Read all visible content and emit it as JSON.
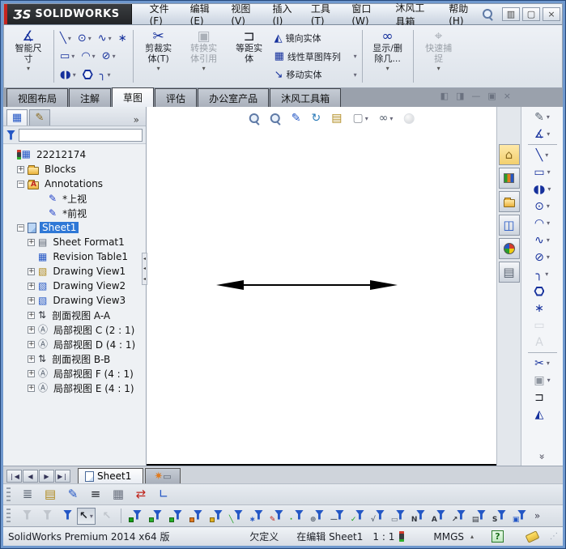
{
  "app": {
    "logo_mark": "ƷS",
    "logo_text": "SOLIDWORKS"
  },
  "menu_bar": {
    "items": [
      "文件(F)",
      "编辑(E)",
      "视图(V)",
      "插入(I)",
      "工具(T)",
      "窗口(W)",
      "沐风工具箱",
      "帮助(H)"
    ]
  },
  "window_controls": [
    {
      "name": "app-minimize-button",
      "glyph": "▥"
    },
    {
      "name": "app-restore-button",
      "glyph": "▢"
    },
    {
      "name": "app-close-button",
      "glyph": "×"
    }
  ],
  "icons": {
    "smart-dimension": {
      "g": "∡",
      "c": "#15309c"
    },
    "line": {
      "g": "╲",
      "c": "#15309c"
    },
    "rectangle": {
      "g": "▭",
      "c": "#15309c"
    },
    "slot": {
      "g": "◖◗",
      "c": "#15309c"
    },
    "circle": {
      "g": "⊙",
      "c": "#15309c"
    },
    "arc": {
      "g": "◠",
      "c": "#15309c"
    },
    "polygon": {
      "cls": "hex"
    },
    "spline": {
      "g": "∿",
      "c": "#15309c"
    },
    "ellipse": {
      "g": "⊘",
      "c": "#15309c"
    },
    "fillet": {
      "g": "╮",
      "c": "#15309c"
    },
    "point": {
      "g": "∗",
      "c": "#15309c"
    },
    "trim": {
      "g": "✂",
      "c": "#15309c"
    },
    "convert-entities": {
      "g": "▣",
      "c": "#8d949e"
    },
    "offset": {
      "g": "⊐",
      "c": "#1c1f26"
    },
    "mirror": {
      "g": "◭",
      "c": "#15309c"
    },
    "linear-pattern": {
      "g": "▦",
      "c": "#15309c"
    },
    "move": {
      "g": "↘",
      "c": "#15309c"
    },
    "display-delete-relations": {
      "g": "∞",
      "c": "#15309c"
    },
    "quick-snaps": {
      "g": "⌖",
      "c": "#8d949e"
    },
    "sketch": {
      "g": "✎",
      "c": "#5a6472"
    },
    "plane": {
      "g": "▭",
      "c": "#aab0b8"
    },
    "text": {
      "g": "A",
      "c": "#aab0b8"
    },
    "zoom-to-fit": {
      "cls": "mag"
    },
    "zoom-to-area": {
      "cls": "mag"
    },
    "zoom-to-selection": {
      "g": "✎",
      "c": "#2457c5"
    },
    "rotate-view": {
      "g": "↻",
      "c": "#2a7ab8"
    },
    "3d-drawing-view": {
      "g": "▤",
      "c": "#b08a1e"
    },
    "view-orientation": {
      "g": "▢",
      "c": "#878d96"
    },
    "hide-show-items": {
      "g": "∞",
      "c": "#5a6472"
    },
    "apply-scene": {
      "cls": "sphere"
    },
    "home": {
      "g": "⌂",
      "c": "#8a6a1f"
    },
    "design-library": {
      "cls": "books"
    },
    "file-explorer": {
      "cls": "folder"
    },
    "view-palette": {
      "g": "◫",
      "c": "#2457c5"
    },
    "appearances": {
      "cls": "ball"
    },
    "custom-properties": {
      "g": "▤",
      "c": "#5a6472"
    },
    "fm-tree": {
      "g": "▦",
      "c": "#2457c5"
    },
    "pm-hand": {
      "g": "✎",
      "c": "#8a6a1f"
    },
    "filter-funnel": {
      "cls": "funnel-solo"
    },
    "tree-root": {
      "cls": "root"
    },
    "blocks": {
      "cls": "folder"
    },
    "annotations": {
      "cls": "folder folderA"
    },
    "view-annotation": {
      "g": "✎",
      "c": "#2141c8"
    },
    "sheet": {
      "cls": "page pageb"
    },
    "sheet-format": {
      "g": "▤",
      "c": "#5a6472"
    },
    "revision-table": {
      "g": "▦",
      "c": "#2457c5"
    },
    "drawing-view-gold": {
      "g": "▧",
      "c": "#b08a1e"
    },
    "drawing-view": {
      "g": "▧",
      "c": "#2457c5"
    },
    "section-view": {
      "g": "⇅",
      "c": "#30343c"
    },
    "detail-view": {
      "g": "Ⓐ",
      "c": "#5a6472"
    },
    "layer-properties": {
      "g": "≣",
      "c": "#5a6472"
    },
    "document-layers": {
      "g": "▤",
      "c": "#b08a1e"
    },
    "line-color": {
      "g": "✎",
      "c": "#2457c5"
    },
    "line-thickness": {
      "g": "≡",
      "c": "#1c1f26"
    },
    "line-style": {
      "g": "▦",
      "c": "#6b7280"
    },
    "color-display-mode": {
      "g": "⇄",
      "c": "#c0251d"
    },
    "hide-show-edges": {
      "g": "∟",
      "c": "#2457c5"
    },
    "add-sheet": {
      "g": "✷",
      "c": "#e07b1f"
    }
  },
  "ribbon": {
    "smart_dimension": {
      "name": "smart-dimension-button",
      "icon": "smart-dimension",
      "lines": [
        "智能尺",
        "寸"
      ],
      "dropdown": true
    },
    "sketch_grid": [
      [
        {
          "name": "line-tool",
          "icon": "line",
          "dd": true
        },
        {
          "name": "circle-tool",
          "icon": "circle",
          "dd": true
        },
        {
          "name": "spline-tool",
          "icon": "spline",
          "dd": true
        },
        {
          "name": "point-tool",
          "icon": "point",
          "dd": false
        }
      ],
      [
        {
          "name": "rectangle-tool",
          "icon": "rectangle",
          "dd": true
        },
        {
          "name": "arc-tool",
          "icon": "arc",
          "dd": true
        },
        {
          "name": "ellipse-tool",
          "icon": "ellipse",
          "dd": true
        }
      ],
      [
        {
          "name": "slot-tool",
          "icon": "slot",
          "dd": true
        },
        {
          "name": "polygon-tool",
          "icon": "polygon",
          "dd": false
        },
        {
          "name": "fillet-tool",
          "icon": "fillet",
          "dd": true
        }
      ]
    ],
    "big_buttons": [
      {
        "name": "trim-entities-button",
        "icon": "trim",
        "lines": [
          "剪裁实",
          "体(T)"
        ],
        "dropdown": true
      },
      {
        "name": "convert-entities-button",
        "icon": "convert-entities",
        "lines": [
          "转换实",
          "体引用"
        ],
        "dropdown": true,
        "disabled": true
      },
      {
        "name": "offset-entities-button",
        "icon": "offset",
        "lines": [
          "等距实",
          "体"
        ],
        "dropdown": false
      }
    ],
    "stack_buttons": [
      {
        "name": "mirror-entities-button",
        "icon": "mirror",
        "label": "镜向实体",
        "dd": false
      },
      {
        "name": "linear-sketch-pattern-button",
        "icon": "linear-pattern",
        "label": "线性草图阵列",
        "dd": true
      },
      {
        "name": "move-entities-button",
        "icon": "move",
        "label": "移动实体",
        "dd": true
      }
    ],
    "big_buttons2": [
      {
        "name": "display-delete-relations-button",
        "icon": "display-delete-relations",
        "lines": [
          "显示/删",
          "除几..."
        ],
        "dropdown": true
      },
      {
        "name": "quick-snaps-button",
        "icon": "quick-snaps",
        "lines": [
          "快速捕",
          "捉"
        ],
        "dropdown": true,
        "disabled": true
      }
    ]
  },
  "command_tabs": {
    "items": [
      "视图布局",
      "注解",
      "草图",
      "评估",
      "办公室产品",
      "沐风工具箱"
    ],
    "active": "草图"
  },
  "doc_controls": [
    {
      "name": "collapse-pane-left-button",
      "glyph": "◧"
    },
    {
      "name": "collapse-pane-right-button",
      "glyph": "◨"
    },
    {
      "name": "doc-minimize-button",
      "glyph": "—"
    },
    {
      "name": "doc-restore-button",
      "glyph": "▣"
    },
    {
      "name": "doc-close-button",
      "glyph": "×"
    }
  ],
  "left_panel": {
    "tabs": [
      {
        "name": "featuremanager-tree-tab",
        "icon": "fm-tree",
        "active": true
      },
      {
        "name": "propertymanager-tab",
        "icon": "pm-hand",
        "active": false
      }
    ],
    "more_glyph": "»",
    "filter": {
      "value": "",
      "placeholder": ""
    }
  },
  "feature_tree": [
    {
      "label": "22212174",
      "depth": 0,
      "icon": "tree-root",
      "expand": null,
      "selected": false
    },
    {
      "label": "Blocks",
      "depth": 1,
      "icon": "blocks",
      "expand": "+",
      "selected": false
    },
    {
      "label": "Annotations",
      "depth": 1,
      "icon": "annotations",
      "expand": "-",
      "selected": false
    },
    {
      "label": "*上视",
      "depth": 3,
      "icon": "view-annotation",
      "expand": null,
      "selected": false
    },
    {
      "label": "*前视",
      "depth": 3,
      "icon": "view-annotation",
      "expand": null,
      "selected": false
    },
    {
      "label": "Sheet1",
      "depth": 1,
      "icon": "sheet",
      "expand": "-",
      "selected": true
    },
    {
      "label": "Sheet Format1",
      "depth": 2,
      "icon": "sheet-format",
      "expand": "+",
      "selected": false
    },
    {
      "label": "Revision Table1",
      "depth": 2,
      "icon": "revision-table",
      "expand": null,
      "selected": false
    },
    {
      "label": "Drawing View1",
      "depth": 2,
      "icon": "drawing-view-gold",
      "expand": "+",
      "selected": false
    },
    {
      "label": "Drawing View2",
      "depth": 2,
      "icon": "drawing-view",
      "expand": "+",
      "selected": false
    },
    {
      "label": "Drawing View3",
      "depth": 2,
      "icon": "drawing-view",
      "expand": "+",
      "selected": false
    },
    {
      "label": "剖面视图 A-A",
      "depth": 2,
      "icon": "section-view",
      "expand": "+",
      "selected": false
    },
    {
      "label": "局部视图 C (2 : 1)",
      "depth": 2,
      "icon": "detail-view",
      "expand": "+",
      "selected": false
    },
    {
      "label": "局部视图 D (4 : 1)",
      "depth": 2,
      "icon": "detail-view",
      "expand": "+",
      "selected": false
    },
    {
      "label": "剖面视图 B-B",
      "depth": 2,
      "icon": "section-view",
      "expand": "+",
      "selected": false
    },
    {
      "label": "局部视图 F (4 : 1)",
      "depth": 2,
      "icon": "detail-view",
      "expand": "+",
      "selected": false
    },
    {
      "label": "局部视图 E (4 : 1)",
      "depth": 2,
      "icon": "detail-view",
      "expand": "+",
      "selected": false
    }
  ],
  "hud_toolbar": [
    {
      "name": "zoom-to-fit",
      "icon": "zoom-to-fit",
      "dd": false
    },
    {
      "name": "zoom-to-area",
      "icon": "zoom-to-area",
      "dd": false
    },
    {
      "name": "zoom-to-selection",
      "icon": "zoom-to-selection",
      "dd": false
    },
    {
      "name": "rotate-view",
      "icon": "rotate-view",
      "dd": false
    },
    {
      "name": "3d-drawing-view",
      "icon": "3d-drawing-view",
      "dd": false
    },
    {
      "name": "view-orientation",
      "icon": "view-orientation",
      "dd": true
    },
    {
      "name": "hide-show-items",
      "icon": "hide-show-items",
      "dd": true
    },
    {
      "name": "apply-scene",
      "icon": "apply-scene",
      "dd": false,
      "gray": true
    }
  ],
  "canvas": {
    "annotation": "horizontal double-headed dimension arrow"
  },
  "task_pane": [
    {
      "name": "solidworks-resources",
      "icon": "home",
      "active": true
    },
    {
      "name": "design-library",
      "icon": "design-library",
      "active": false
    },
    {
      "name": "file-explorer",
      "icon": "file-explorer",
      "active": false
    },
    {
      "name": "view-palette",
      "icon": "view-palette",
      "active": false
    },
    {
      "name": "appearances-scenes",
      "icon": "appearances",
      "active": false
    },
    {
      "name": "custom-properties",
      "icon": "custom-properties",
      "active": false
    }
  ],
  "sketch_toolbar": [
    {
      "name": "sketch-flyout",
      "icon": "sketch",
      "dd": true
    },
    {
      "name": "smart-dimension",
      "icon": "smart-dimension",
      "dd": true
    },
    {
      "sep": true
    },
    {
      "name": "line",
      "icon": "line",
      "dd": true
    },
    {
      "name": "rectangle",
      "icon": "rectangle",
      "dd": true
    },
    {
      "name": "slot",
      "icon": "slot",
      "dd": true
    },
    {
      "name": "circle",
      "icon": "circle",
      "dd": true
    },
    {
      "name": "arc",
      "icon": "arc",
      "dd": true
    },
    {
      "name": "spline",
      "icon": "spline",
      "dd": true
    },
    {
      "name": "ellipse",
      "icon": "ellipse",
      "dd": true
    },
    {
      "name": "fillet",
      "icon": "fillet",
      "dd": true
    },
    {
      "name": "polygon",
      "icon": "polygon",
      "dd": false
    },
    {
      "name": "point",
      "icon": "point",
      "dd": false
    },
    {
      "name": "plane",
      "icon": "plane",
      "dd": false,
      "gray": true
    },
    {
      "name": "text",
      "icon": "text",
      "dd": false,
      "gray": true
    },
    {
      "sep": true
    },
    {
      "name": "trim-entities",
      "icon": "trim",
      "dd": true
    },
    {
      "name": "convert-entities",
      "icon": "convert-entities",
      "dd": true
    },
    {
      "name": "offset-entities",
      "icon": "offset",
      "dd": false
    },
    {
      "name": "mirror-entities",
      "icon": "mirror",
      "dd": false
    }
  ],
  "sketch_toolbar_more_glyph": "»",
  "sheet_bar": {
    "nav": [
      {
        "name": "first-sheet-button",
        "glyph": "❘◀"
      },
      {
        "name": "previous-sheet-button",
        "glyph": "◀"
      },
      {
        "name": "next-sheet-button",
        "glyph": "▶"
      },
      {
        "name": "last-sheet-button",
        "glyph": "▶❘"
      }
    ],
    "active_sheet": "Sheet1"
  },
  "line_format_toolbar": [
    {
      "name": "layer-properties",
      "icon": "layer-properties"
    },
    {
      "name": "document-layers",
      "icon": "document-layers"
    },
    {
      "name": "line-color",
      "icon": "line-color"
    },
    {
      "name": "line-thickness",
      "icon": "line-thickness"
    },
    {
      "name": "line-style",
      "icon": "line-style"
    },
    {
      "name": "color-display-mode",
      "icon": "color-display-mode"
    },
    {
      "name": "hide-show-edges",
      "icon": "hide-show-edges"
    }
  ],
  "filter_toolbar": [
    {
      "n": "filter-off",
      "funnel": "#9aa0a8",
      "gray": true
    },
    {
      "n": "clear-all-filters",
      "funnel": "#9aa0a8",
      "gray": true
    },
    {
      "n": "toggle-selection-filters",
      "funnel": "#2457c5"
    },
    {
      "n": "select-tool",
      "g": "↖",
      "c": "#1c1f26",
      "pressed": true,
      "dd": true
    },
    {
      "n": "select-by-filter",
      "g": "↖",
      "c": "#9aa0a8",
      "gray": true
    },
    {
      "sep": true
    },
    {
      "n": "filter-vertices",
      "funnel": "#2457c5",
      "acc": "#18a018"
    },
    {
      "n": "filter-edges",
      "funnel": "#2457c5",
      "acc": "#2db02d"
    },
    {
      "n": "filter-faces",
      "funnel": "#2457c5",
      "acc": "#28b028"
    },
    {
      "n": "filter-surface-bodies",
      "funnel": "#2457c5",
      "acc": "#e07b1f"
    },
    {
      "n": "filter-solid-bodies",
      "funnel": "#2457c5",
      "acc": "#e0b020"
    },
    {
      "n": "filter-sketch-segments",
      "funnel": "#2457c5",
      "ag": "╲",
      "agc": "#18a018"
    },
    {
      "n": "filter-sketch-points",
      "funnel": "#2457c5",
      "ag": "∗",
      "agc": "#2457c5"
    },
    {
      "n": "filter-sketches",
      "funnel": "#2457c5",
      "ag": "✎",
      "agc": "#c0251d"
    },
    {
      "n": "filter-midpoints",
      "funnel": "#2457c5",
      "ag": "·",
      "agc": "#18a018"
    },
    {
      "n": "filter-center-marks",
      "funnel": "#2457c5",
      "ag": "⊕",
      "agc": "#5a6472"
    },
    {
      "n": "filter-centerlines",
      "funnel": "#2457c5",
      "ag": "—",
      "agc": "#5a6472"
    },
    {
      "n": "filter-dimensions",
      "funnel": "#2457c5",
      "ag": "✓",
      "agc": "#18a018"
    },
    {
      "n": "filter-surface-finish-symbols",
      "funnel": "#2457c5",
      "ag": "√",
      "agc": "#5a6472"
    },
    {
      "n": "filter-geometric-tolerances",
      "funnel": "#2457c5",
      "ag": "▭",
      "agc": "#5a6472"
    },
    {
      "n": "filter-notes",
      "funnel": "#2457c5",
      "ag": "N",
      "agc": "#30343c"
    },
    {
      "n": "filter-balloons",
      "funnel": "#2457c5",
      "ag": "A",
      "agc": "#30343c"
    },
    {
      "n": "filter-weld-symbols",
      "funnel": "#2457c5",
      "ag": "↗",
      "agc": "#30343c"
    },
    {
      "n": "filter-datums",
      "funnel": "#2457c5",
      "ag": "▤",
      "agc": "#30343c"
    },
    {
      "n": "filter-dowel-pins",
      "funnel": "#2457c5",
      "ag": "S",
      "agc": "#30343c"
    },
    {
      "n": "filter-blocks",
      "funnel": "#2457c5",
      "ag": "▣",
      "agc": "#2457c5"
    }
  ],
  "filter_more_glyph": "»",
  "status_bar": {
    "product": "SolidWorks Premium 2014 x64 版",
    "defined_state": "欠定义",
    "editing": "在编辑 Sheet1",
    "scale": "1 : 1",
    "units": "MMGS",
    "units_arrow": "▴",
    "help_glyph": "?",
    "grip_glyph": "⋰"
  }
}
